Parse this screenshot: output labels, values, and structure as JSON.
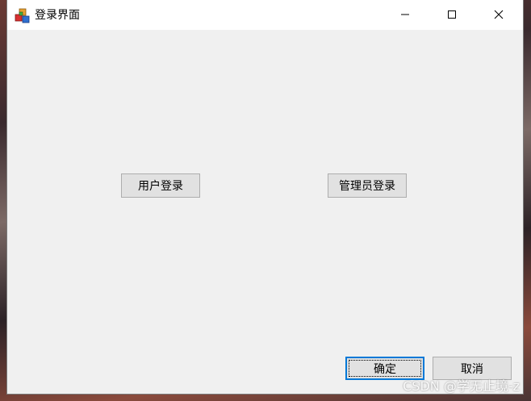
{
  "window": {
    "title": "登录界面",
    "icons": {
      "app": "app-cubes-icon",
      "minimize": "minimize-icon",
      "maximize": "maximize-icon",
      "close": "close-icon"
    }
  },
  "buttons": {
    "user_login": "用户登录",
    "admin_login": "管理员登录",
    "ok": "确定",
    "cancel": "取消"
  },
  "watermark": "CSDN @学无止境-z",
  "colors": {
    "window_bg": "#f0f0f0",
    "button_bg": "#e1e1e1",
    "focus_border": "#0078d7"
  }
}
